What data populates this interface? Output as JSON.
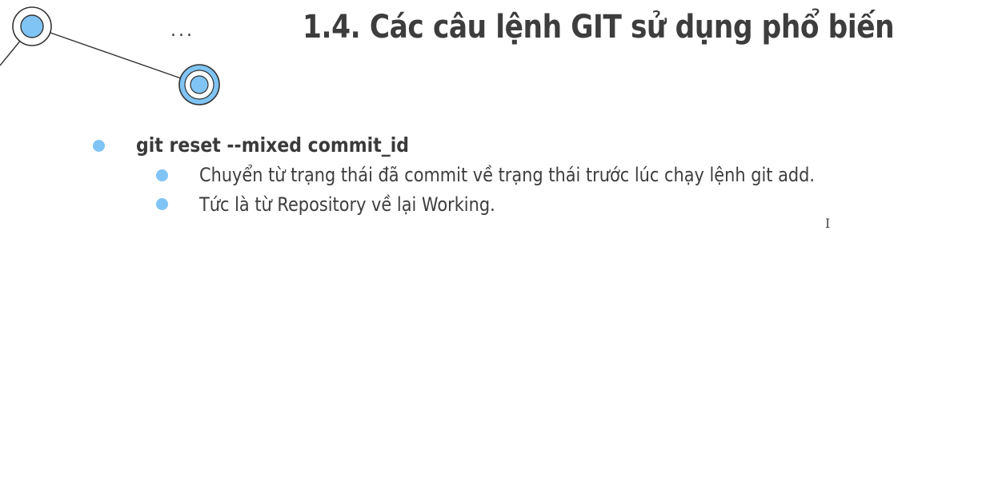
{
  "slide": {
    "decoration_ellipsis": "...",
    "title": "1.4. Các câu lệnh GIT sử dụng phổ biến",
    "bullets": [
      {
        "text": "git reset --mixed commit_id",
        "children": [
          {
            "text": "Chuyển từ trạng thái đã commit về trạng thái trước lúc chạy lệnh git add."
          },
          {
            "text": "Tức là từ Repository về lại Working."
          }
        ]
      }
    ]
  },
  "colors": {
    "accent": "#7fc4f4",
    "title": "#3d3d3d",
    "text": "#3a3a3a"
  },
  "icons": {
    "cursor": "text-cursor-icon"
  }
}
